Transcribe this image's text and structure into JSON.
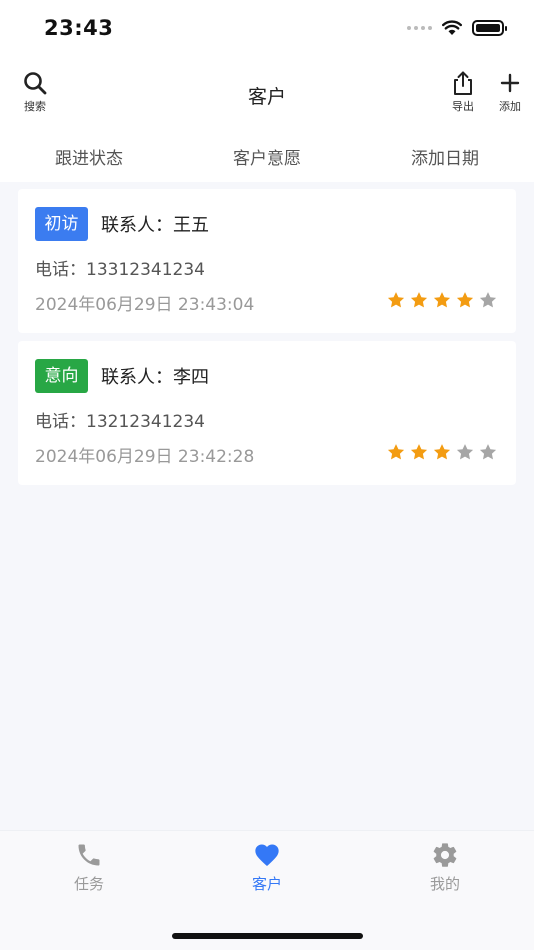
{
  "status_bar": {
    "time": "23:43"
  },
  "navbar": {
    "title": "客户",
    "search_label": "搜索",
    "export_label": "导出",
    "add_label": "添加"
  },
  "filters": [
    "跟进状态",
    "客户意愿",
    "添加日期"
  ],
  "customers": [
    {
      "tag": "初访",
      "tag_color": "#3b7cf0",
      "contact": "联系人：王五",
      "phone": "电话：13312341234",
      "date": "2024年06月29日 23:43:04",
      "rating": 4,
      "rating_max": 5
    },
    {
      "tag": "意向",
      "tag_color": "#28a745",
      "contact": "联系人：李四",
      "phone": "电话：13212341234",
      "date": "2024年06月29日 23:42:28",
      "rating": 3,
      "rating_max": 5
    }
  ],
  "tabbar": {
    "items": [
      {
        "label": "任务",
        "icon": "phone-icon",
        "active": false
      },
      {
        "label": "客户",
        "icon": "heart-icon",
        "active": true
      },
      {
        "label": "我的",
        "icon": "gear-icon",
        "active": false
      }
    ]
  },
  "colors": {
    "accent": "#3478f6",
    "star_on": "#f39c12",
    "star_off": "#a6a6a6",
    "tab_inactive": "#9a9a9a"
  }
}
